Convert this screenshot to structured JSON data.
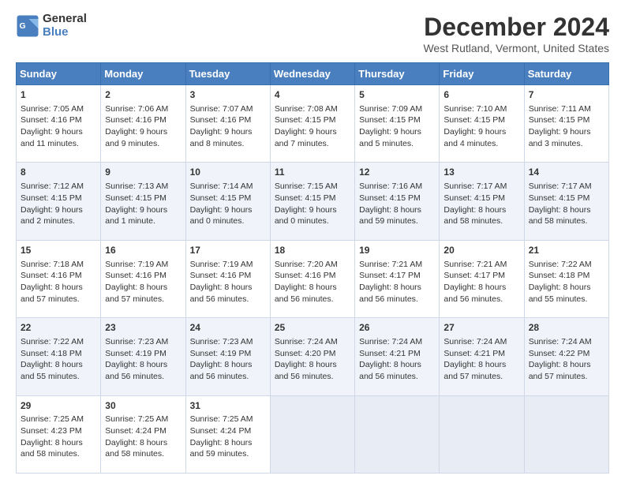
{
  "header": {
    "logo_general": "General",
    "logo_blue": "Blue",
    "title": "December 2024",
    "subtitle": "West Rutland, Vermont, United States"
  },
  "columns": [
    "Sunday",
    "Monday",
    "Tuesday",
    "Wednesday",
    "Thursday",
    "Friday",
    "Saturday"
  ],
  "weeks": [
    [
      {
        "day": "1",
        "sunrise": "Sunrise: 7:05 AM",
        "sunset": "Sunset: 4:16 PM",
        "daylight": "Daylight: 9 hours and 11 minutes."
      },
      {
        "day": "2",
        "sunrise": "Sunrise: 7:06 AM",
        "sunset": "Sunset: 4:16 PM",
        "daylight": "Daylight: 9 hours and 9 minutes."
      },
      {
        "day": "3",
        "sunrise": "Sunrise: 7:07 AM",
        "sunset": "Sunset: 4:16 PM",
        "daylight": "Daylight: 9 hours and 8 minutes."
      },
      {
        "day": "4",
        "sunrise": "Sunrise: 7:08 AM",
        "sunset": "Sunset: 4:15 PM",
        "daylight": "Daylight: 9 hours and 7 minutes."
      },
      {
        "day": "5",
        "sunrise": "Sunrise: 7:09 AM",
        "sunset": "Sunset: 4:15 PM",
        "daylight": "Daylight: 9 hours and 5 minutes."
      },
      {
        "day": "6",
        "sunrise": "Sunrise: 7:10 AM",
        "sunset": "Sunset: 4:15 PM",
        "daylight": "Daylight: 9 hours and 4 minutes."
      },
      {
        "day": "7",
        "sunrise": "Sunrise: 7:11 AM",
        "sunset": "Sunset: 4:15 PM",
        "daylight": "Daylight: 9 hours and 3 minutes."
      }
    ],
    [
      {
        "day": "8",
        "sunrise": "Sunrise: 7:12 AM",
        "sunset": "Sunset: 4:15 PM",
        "daylight": "Daylight: 9 hours and 2 minutes."
      },
      {
        "day": "9",
        "sunrise": "Sunrise: 7:13 AM",
        "sunset": "Sunset: 4:15 PM",
        "daylight": "Daylight: 9 hours and 1 minute."
      },
      {
        "day": "10",
        "sunrise": "Sunrise: 7:14 AM",
        "sunset": "Sunset: 4:15 PM",
        "daylight": "Daylight: 9 hours and 0 minutes."
      },
      {
        "day": "11",
        "sunrise": "Sunrise: 7:15 AM",
        "sunset": "Sunset: 4:15 PM",
        "daylight": "Daylight: 9 hours and 0 minutes."
      },
      {
        "day": "12",
        "sunrise": "Sunrise: 7:16 AM",
        "sunset": "Sunset: 4:15 PM",
        "daylight": "Daylight: 8 hours and 59 minutes."
      },
      {
        "day": "13",
        "sunrise": "Sunrise: 7:17 AM",
        "sunset": "Sunset: 4:15 PM",
        "daylight": "Daylight: 8 hours and 58 minutes."
      },
      {
        "day": "14",
        "sunrise": "Sunrise: 7:17 AM",
        "sunset": "Sunset: 4:15 PM",
        "daylight": "Daylight: 8 hours and 58 minutes."
      }
    ],
    [
      {
        "day": "15",
        "sunrise": "Sunrise: 7:18 AM",
        "sunset": "Sunset: 4:16 PM",
        "daylight": "Daylight: 8 hours and 57 minutes."
      },
      {
        "day": "16",
        "sunrise": "Sunrise: 7:19 AM",
        "sunset": "Sunset: 4:16 PM",
        "daylight": "Daylight: 8 hours and 57 minutes."
      },
      {
        "day": "17",
        "sunrise": "Sunrise: 7:19 AM",
        "sunset": "Sunset: 4:16 PM",
        "daylight": "Daylight: 8 hours and 56 minutes."
      },
      {
        "day": "18",
        "sunrise": "Sunrise: 7:20 AM",
        "sunset": "Sunset: 4:16 PM",
        "daylight": "Daylight: 8 hours and 56 minutes."
      },
      {
        "day": "19",
        "sunrise": "Sunrise: 7:21 AM",
        "sunset": "Sunset: 4:17 PM",
        "daylight": "Daylight: 8 hours and 56 minutes."
      },
      {
        "day": "20",
        "sunrise": "Sunrise: 7:21 AM",
        "sunset": "Sunset: 4:17 PM",
        "daylight": "Daylight: 8 hours and 56 minutes."
      },
      {
        "day": "21",
        "sunrise": "Sunrise: 7:22 AM",
        "sunset": "Sunset: 4:18 PM",
        "daylight": "Daylight: 8 hours and 55 minutes."
      }
    ],
    [
      {
        "day": "22",
        "sunrise": "Sunrise: 7:22 AM",
        "sunset": "Sunset: 4:18 PM",
        "daylight": "Daylight: 8 hours and 55 minutes."
      },
      {
        "day": "23",
        "sunrise": "Sunrise: 7:23 AM",
        "sunset": "Sunset: 4:19 PM",
        "daylight": "Daylight: 8 hours and 56 minutes."
      },
      {
        "day": "24",
        "sunrise": "Sunrise: 7:23 AM",
        "sunset": "Sunset: 4:19 PM",
        "daylight": "Daylight: 8 hours and 56 minutes."
      },
      {
        "day": "25",
        "sunrise": "Sunrise: 7:24 AM",
        "sunset": "Sunset: 4:20 PM",
        "daylight": "Daylight: 8 hours and 56 minutes."
      },
      {
        "day": "26",
        "sunrise": "Sunrise: 7:24 AM",
        "sunset": "Sunset: 4:21 PM",
        "daylight": "Daylight: 8 hours and 56 minutes."
      },
      {
        "day": "27",
        "sunrise": "Sunrise: 7:24 AM",
        "sunset": "Sunset: 4:21 PM",
        "daylight": "Daylight: 8 hours and 57 minutes."
      },
      {
        "day": "28",
        "sunrise": "Sunrise: 7:24 AM",
        "sunset": "Sunset: 4:22 PM",
        "daylight": "Daylight: 8 hours and 57 minutes."
      }
    ],
    [
      {
        "day": "29",
        "sunrise": "Sunrise: 7:25 AM",
        "sunset": "Sunset: 4:23 PM",
        "daylight": "Daylight: 8 hours and 58 minutes."
      },
      {
        "day": "30",
        "sunrise": "Sunrise: 7:25 AM",
        "sunset": "Sunset: 4:24 PM",
        "daylight": "Daylight: 8 hours and 58 minutes."
      },
      {
        "day": "31",
        "sunrise": "Sunrise: 7:25 AM",
        "sunset": "Sunset: 4:24 PM",
        "daylight": "Daylight: 8 hours and 59 minutes."
      },
      null,
      null,
      null,
      null
    ]
  ]
}
